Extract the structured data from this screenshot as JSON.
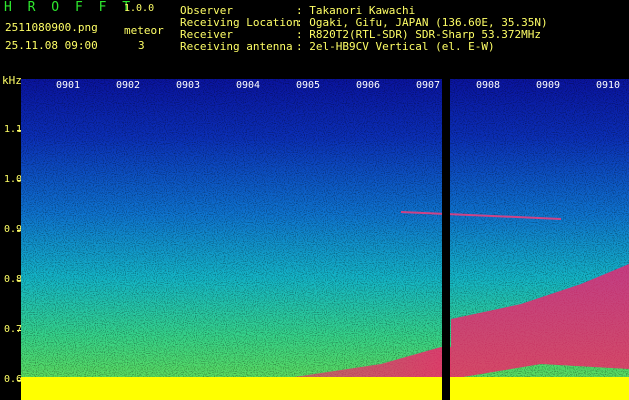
{
  "header": {
    "app_title": "H R O F F T",
    "version": "1.0.0",
    "filename": "2511080900.png",
    "meteor_label": "meteor",
    "datetime": "25.11.08 09:00",
    "meteor_count": "3",
    "fields": [
      {
        "label": "Observer",
        "value": ": Takanori Kawachi"
      },
      {
        "label": "Receiving Location",
        "value": ": Ogaki, Gifu, JAPAN (136.60E, 35.35N)"
      },
      {
        "label": "Receiver",
        "value": ": R820T2(RTL-SDR) SDR-Sharp 53.372MHz"
      },
      {
        "label": "Receiving antenna",
        "value": ": 2el-HB9CV Vertical (el. E-W)"
      }
    ]
  },
  "spectrogram": {
    "y_unit": "kHz",
    "y_ticks": [
      "1.1",
      "1.0",
      "0.9",
      "0.8",
      "0.7",
      "0.6"
    ],
    "x_ticks": [
      "0901",
      "0902",
      "0903",
      "0904",
      "0905",
      "0906",
      "0907",
      "0908",
      "0909",
      "0910"
    ],
    "colors": {
      "low": "#0a14a0",
      "mid": "#14b6c8",
      "high": "#ff1a6a",
      "floor": "#ffff00",
      "gap": "#000000"
    }
  }
}
